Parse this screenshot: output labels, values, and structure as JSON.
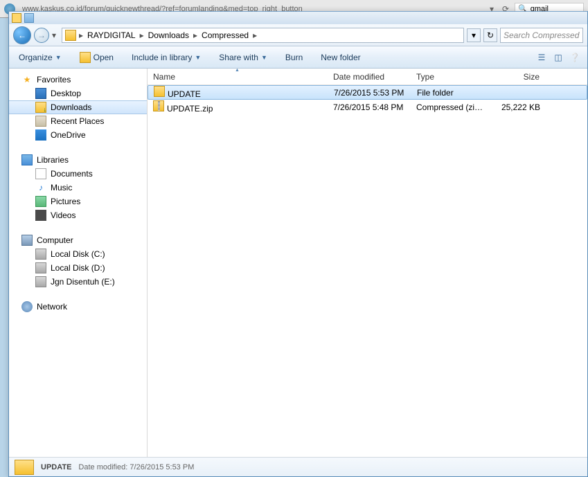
{
  "browser": {
    "url": "www.kaskus.co.id/forum/quicknewthread/?ref=forumlanding&med=top_right_button",
    "search_value": "gmail"
  },
  "breadcrumb": {
    "items": [
      "RAYDIGITAL",
      "Downloads",
      "Compressed"
    ]
  },
  "search": {
    "placeholder": "Search Compressed"
  },
  "toolbar": {
    "organize": "Organize",
    "open": "Open",
    "include": "Include in library",
    "share": "Share with",
    "burn": "Burn",
    "newfolder": "New folder"
  },
  "sidebar": {
    "favorites": {
      "label": "Favorites",
      "items": [
        "Desktop",
        "Downloads",
        "Recent Places",
        "OneDrive"
      ]
    },
    "libraries": {
      "label": "Libraries",
      "items": [
        "Documents",
        "Music",
        "Pictures",
        "Videos"
      ]
    },
    "computer": {
      "label": "Computer",
      "items": [
        "Local Disk (C:)",
        "Local Disk (D:)",
        "Jgn Disentuh (E:)"
      ]
    },
    "network": {
      "label": "Network"
    }
  },
  "columns": {
    "name": "Name",
    "date": "Date modified",
    "type": "Type",
    "size": "Size"
  },
  "files": [
    {
      "name": "UPDATE",
      "date": "7/26/2015 5:53 PM",
      "type": "File folder",
      "size": ""
    },
    {
      "name": "UPDATE.zip",
      "date": "7/26/2015 5:48 PM",
      "type": "Compressed (zipp...",
      "size": "25,222 KB"
    }
  ],
  "status": {
    "name": "UPDATE",
    "sub": "Date modified: 7/26/2015 5:53 PM"
  }
}
